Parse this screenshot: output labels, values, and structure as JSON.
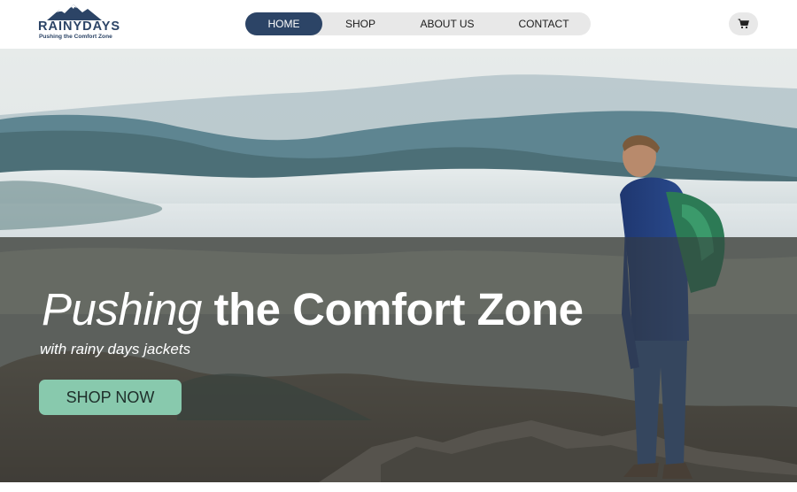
{
  "brand": {
    "name": "RAINYDAYS",
    "tagline": "Pushing the Comfort Zone"
  },
  "nav": {
    "items": [
      {
        "label": "HOME",
        "active": true
      },
      {
        "label": "SHOP",
        "active": false
      },
      {
        "label": "ABOUT US",
        "active": false
      },
      {
        "label": "CONTACT",
        "active": false
      }
    ]
  },
  "cart": {
    "icon": "shopping-cart-icon"
  },
  "hero": {
    "title_italic": "Pushing",
    "title_bold": "the Comfort Zone",
    "subtitle": "with rainy days jackets",
    "cta_label": "SHOP NOW"
  },
  "colors": {
    "brand_navy": "#2c4466",
    "nav_bg": "#e8e8e8",
    "cta_green": "#88c9ad"
  }
}
